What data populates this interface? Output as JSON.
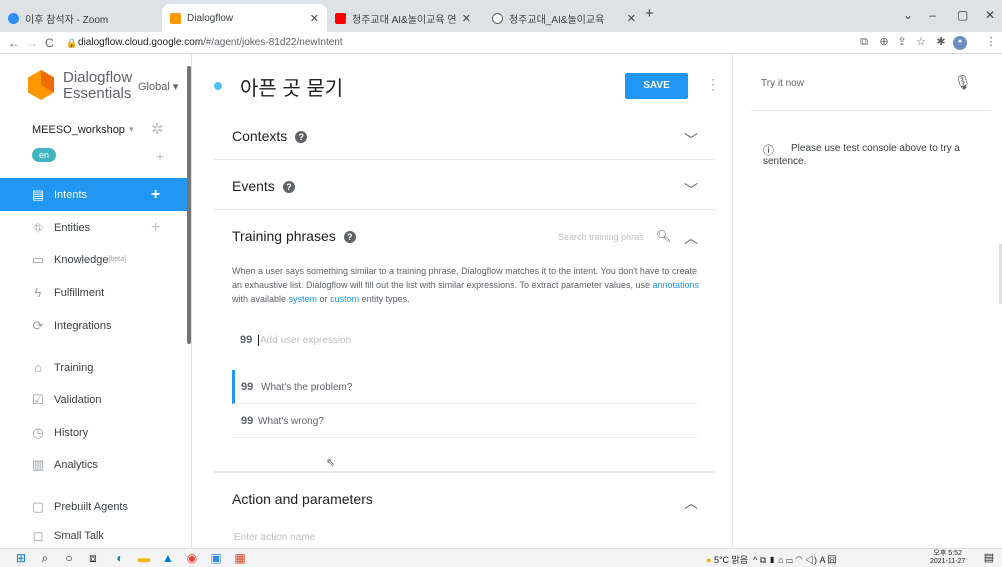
{
  "browser": {
    "tabs": [
      {
        "title": "이후 참석자 - Zoom",
        "icon_color": "#2d8cff"
      },
      {
        "title": "Dialogflow",
        "icon_color": "#ff9800"
      },
      {
        "title": "청주교대 AI&놀이교육 연구소 ·",
        "icon_color": "#ff0000"
      },
      {
        "title": "청주교대_AI&놀이교육",
        "icon_color": "#5f6368"
      }
    ],
    "new_tab": "+",
    "window_controls": {
      "minimize": "–",
      "restore": "▢",
      "close": "✕",
      "menu": "⌄"
    },
    "url_host": "dialogflow.cloud.google.com",
    "url_path": "/#/agent/jokes-81d22/newIntent"
  },
  "sidebar": {
    "brand_line1": "Dialogflow",
    "brand_line2": "Essentials",
    "region": "Global ▾",
    "agent_name": "MEESO_workshop",
    "agent_dropdown": "▾",
    "language": "en",
    "items": [
      {
        "label": "Intents",
        "icon": "chat-icon",
        "glyph": "▤",
        "plus": "+",
        "active": true
      },
      {
        "label": "Entities",
        "icon": "sitemap-icon",
        "glyph": "⛗",
        "plus": "+",
        "active": false
      },
      {
        "label": "Knowledge",
        "icon": "book-icon",
        "glyph": "▭",
        "beta": "[beta]",
        "active": false
      },
      {
        "label": "Fulfillment",
        "icon": "bolt-icon",
        "glyph": "ϟ",
        "active": false
      },
      {
        "label": "Integrations",
        "icon": "sync-icon",
        "glyph": "⟳",
        "active": false
      },
      {
        "label": "Training",
        "icon": "graduation-cap-icon",
        "glyph": "⌂",
        "active": false
      },
      {
        "label": "Validation",
        "icon": "check-square-icon",
        "glyph": "☑",
        "active": false
      },
      {
        "label": "History",
        "icon": "clock-icon",
        "glyph": "◷",
        "active": false
      },
      {
        "label": "Analytics",
        "icon": "bar-chart-icon",
        "glyph": "▥",
        "active": false
      },
      {
        "label": "Prebuilt Agents",
        "icon": "box-icon",
        "glyph": "▢",
        "active": false
      },
      {
        "label": "Small Talk",
        "icon": "speech-bubble-icon",
        "glyph": "◻",
        "active": false
      }
    ]
  },
  "intent": {
    "title": "아픈 곳 묻기",
    "save_label": "SAVE",
    "sections": {
      "contexts": "Contexts",
      "events": "Events",
      "training": "Training phrases",
      "action": "Action and parameters"
    },
    "help_glyph": "?",
    "search_placeholder": "Search training phras",
    "training_desc_1": "When a user says something similar to a training phrase, Dialogflow matches it to the intent. You don't have to create an exhaustive list. Dialogflow will fill out the list with similar expressions. To extract parameter values, use ",
    "link_annotations": "annotations",
    "training_desc_2": " with available ",
    "link_system": "system",
    "training_desc_3": " or ",
    "link_custom": "custom",
    "training_desc_4": " entity types.",
    "add_expression_placeholder": "Add user expression",
    "quote_glyph": "99",
    "phrases": [
      "What's the problem?",
      "What's wrong?"
    ],
    "action_placeholder": "Enter action name"
  },
  "test_console": {
    "placeholder": "Try it now",
    "info_glyph": "ⓘ",
    "message": "Please use test console above to try a sentence."
  },
  "taskbar": {
    "weather": "5°C 맑음",
    "tray_icons": "^ ⧉ ▮ ⌂ ▭ ◠ ◁) A 囧",
    "time": "오후 5:52",
    "date": "2021-11-27"
  }
}
